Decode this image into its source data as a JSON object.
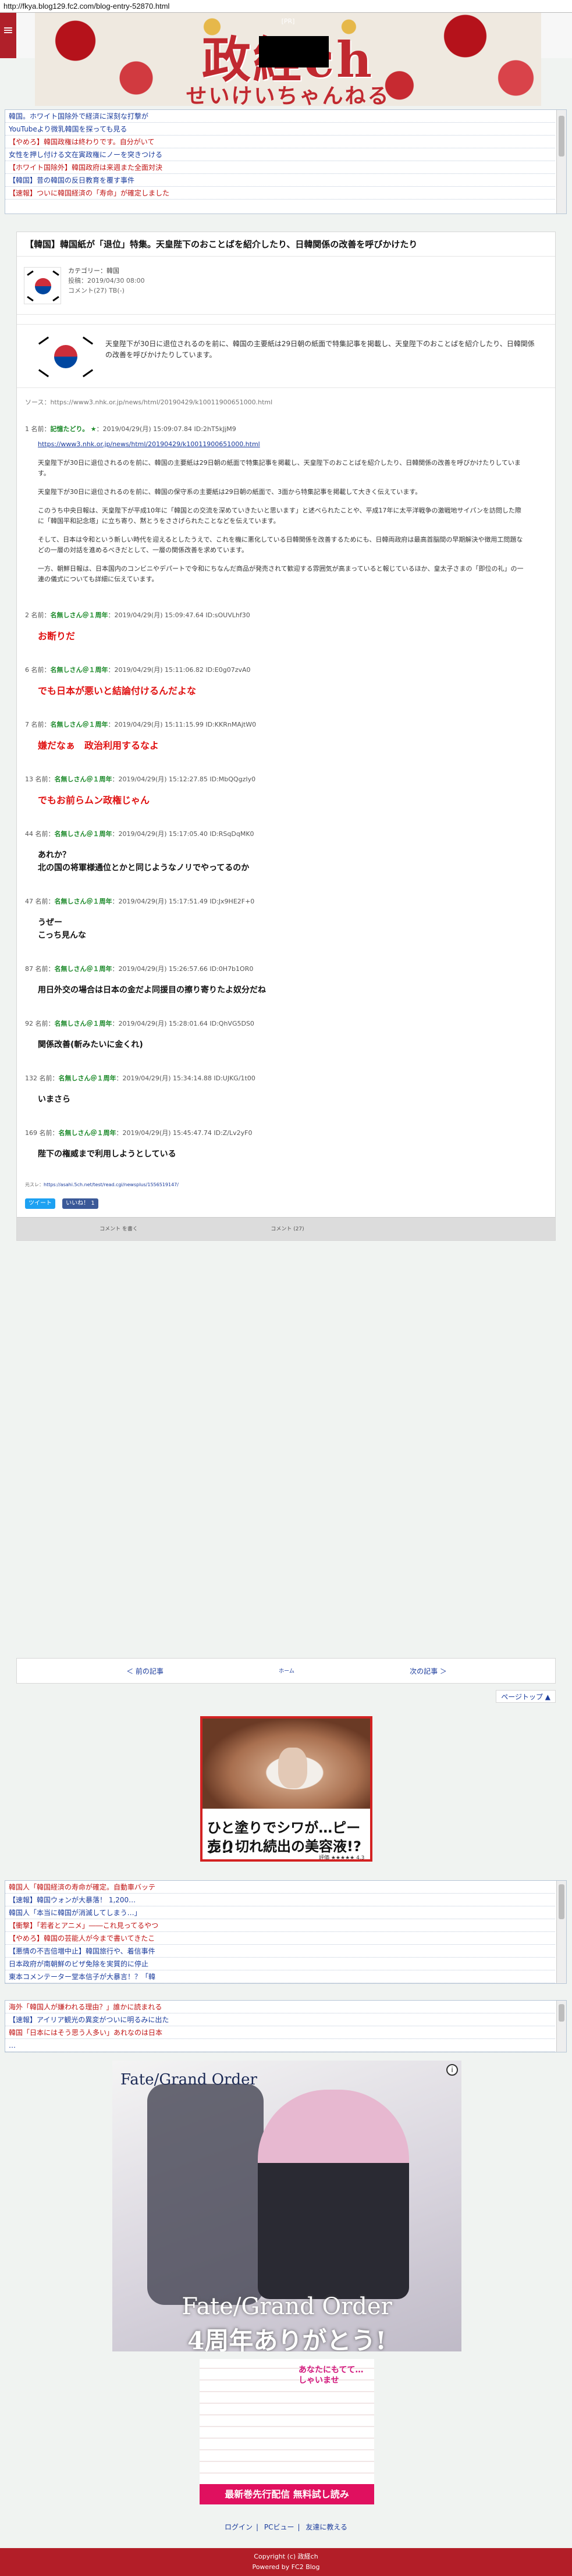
{
  "browser": {
    "url": "http://fkya.blog129.fc2.com/blog-entry-52870.html"
  },
  "header": {
    "menu_icon": "hamburger-icon",
    "pr": "[PR]",
    "title_main": "政経ch",
    "title_sub": "せいけいちゃんねる",
    "accent": "#b0202a"
  },
  "feed_top": [
    "韓国。ホワイト国除外で経済に深刻な打撃が",
    "YouTubeより微乳韓国を探っても見る",
    "【やめろ】韓国政権は終わりです。自分がいて",
    "女性を押し付ける文在寅政権にノーを突きつける",
    "【ホワイト国除外】韓国政府は来週また全面対決",
    "【韓国】昔の韓国の反日教育を覆す事件",
    "【速報】ついに韓国経済の「寿命」が確定しました"
  ],
  "article": {
    "title": "【韓国】韓国紙が「退位」特集。天皇陛下のおことばを紹介したり、日韓関係の改善を呼びかけたり",
    "category": "カテゴリー：韓国",
    "posted": "投稿：2019/04/30 08:00",
    "comments": "コメント(27)  TB(-)",
    "lead": "天皇陛下が30日に退位されるのを前に、韓国の主要紙は29日朝の紙面で特集記事を掲載し、天皇陛下のおことばを紹介したり、日韓関係の改善を呼びかけたりしています。",
    "source": "ソース：https://www3.nhk.or.jp/news/html/20190429/k10011900651000.html",
    "res1_head": {
      "num": "1 名前：",
      "name": "記憶たどり。",
      "rest": "：2019/04/29(月) 15:09:07.84 ID:2hT5kJjM9"
    },
    "res1_link": "https://www3.nhk.or.jp/news/html/20190429/k10011900651000.html",
    "res1_paras": [
      "天皇陛下が30日に退位されるのを前に、韓国の主要紙は29日朝の紙面で特集記事を掲載し、天皇陛下のおことばを紹介したり、日韓関係の改善を呼びかけたりしています。",
      "天皇陛下が30日に退位されるのを前に、韓国の保守系の主要紙は29日朝の紙面で、3面から特集記事を掲載して大きく伝えています。",
      "このうち中央日報は、天皇陛下が平成10年に「韓国との交流を深めていきたいと思います」と述べられたことや、平成17年に太平洋戦争の激戦地サイパンを訪問した際に「韓国平和記念塔」に立ち寄り、黙とうをささげられたことなどを伝えています。",
      "そして、日本は令和という新しい時代を迎えるとしたうえで、これを機に悪化している日韓関係を改善するためにも、日韓両政府は最高首脳間の早期解決や徴用工問題などの一層の対話を進めるべきだとして、一層の関係改善を求めています。",
      "一方、朝鮮日報は、日本国内のコンビニやデパートで令和にちなんだ商品が発売されて歓迎する雰囲気が高まっていると報じているほか、皇太子さまの「即位の礼」の一連の儀式についても詳細に伝えています。"
    ],
    "responses": [
      {
        "head": "2 名前：",
        "name": "名無しさん＠１周年",
        "rest": "：2019/04/29(月) 15:09:47.64 ID:sOUVLhf30",
        "body": "お断りだ",
        "red": true
      },
      {
        "head": "6 名前：",
        "name": "名無しさん＠１周年",
        "rest": "：2019/04/29(月) 15:11:06.82 ID:E0g07zvA0",
        "body": "でも日本が悪いと結論付けるんだよな",
        "red": true
      },
      {
        "head": "7 名前：",
        "name": "名無しさん＠１周年",
        "rest": "：2019/04/29(月) 15:11:15.99 ID:KKRnMAjtW0",
        "body": "嫌だなぁ　政治利用するなよ",
        "red": true
      },
      {
        "head": "13 名前：",
        "name": "名無しさん＠１周年",
        "rest": "：2019/04/29(月) 15:12:27.85 ID:MbQQgzIy0",
        "body": "でもお前らムン政権じゃん",
        "red": true
      },
      {
        "head": "44 名前：",
        "name": "名無しさん＠１周年",
        "rest": "：2019/04/29(月) 15:17:05.40 ID:RSqDqMK0",
        "body": "あれか？\n北の国の将軍様通位とかと同じようなノリでやってるのか",
        "red": false
      },
      {
        "head": "47 名前：",
        "name": "名無しさん＠１周年",
        "rest": "：2019/04/29(月) 15:17:51.49 ID:Jx9HE2F+0",
        "body": "うぜー\nこっち見んな",
        "red": false
      },
      {
        "head": "87 名前：",
        "name": "名無しさん＠１周年",
        "rest": "：2019/04/29(月) 15:26:57.66 ID:0H7b1OR0",
        "body": "用日外交の場合は日本の金だよ同援目の擦り寄りたよ奴分だね",
        "red": false
      },
      {
        "head": "92 名前：",
        "name": "名無しさん＠１周年",
        "rest": "：2019/04/29(月) 15:28:01.64 ID:QhVG5DS0",
        "body": "関係改善(斬みたいに金くれ)",
        "red": false
      },
      {
        "head": "132 名前：",
        "name": "名無しさん＠１周年",
        "rest": "：2019/04/29(月) 15:34:14.88 ID:UJKG/1t00",
        "body": "いまさら",
        "red": false
      },
      {
        "head": "169 名前：",
        "name": "名無しさん＠１周年",
        "rest": "：2019/04/29(月) 15:45:47.74 ID:Z/Lv2yF0",
        "body": "陛下の権威まで利用しようとしている",
        "red": false
      }
    ],
    "src2_label": "元スレ：",
    "src2_link": "https://asahi.5ch.net/test/read.cgi/newsplus/1556519147/",
    "sns_tweet": "ツイート",
    "sns_like": "いいね！ 1",
    "tools": {
      "comment_write": "コメント\nを書く",
      "comment_read": "コメント\n(27)"
    },
    "nav_prev": "＜ 前の記事",
    "nav_home": "ホーム",
    "nav_next": "次の記事 ＞"
  },
  "pagetop": "ページトップ ▲",
  "ad1": {
    "line1": "ひと塗りでシワが…ピーン!!",
    "line2": "売り切れ続出の美容液!?",
    "rating": "評価 ★★★★★ 4.3"
  },
  "feed_mid": [
    "韓国人「韓国経済の寿命が確定。自動車バッテ",
    "【速報】韓国ウォンが大暴落！ 1,200…",
    "韓国人「本当に韓国が消滅してしまう…」",
    "【衝撃】「若者とアニメ」――これ見ってるやつ",
    "【やめろ】韓国の芸能人が今まで書いてきたこ",
    "【悪情の不吉倍増中止】韓国旅行や、着信事件",
    "日本政府が南朝鮮のビザ免除を実質的に停止",
    "東本コメンテーター堂本信子が大暴言！？「韓"
  ],
  "feed_bottom": [
    "海外「韓国人が嫌われる理由？」誰かに読まれる",
    "【速報】アイリア観光の異変がついに明るみに出た",
    "韓国「日本にはそう思う人多い」あれなのは日本",
    "…"
  ],
  "ad2": {
    "logo": "Fate/Grand Order",
    "caption1": "Fate/Grand Order",
    "caption2": "4周年ありがとう!",
    "info_icon": "info-icon"
  },
  "ad3": {
    "manga": "あなたにもてて…しゃいませ",
    "band": "最新巻先行配信 無料試し読み"
  },
  "footer": {
    "links": [
      "ログイン",
      "PCビュー",
      "友達に教える"
    ],
    "copyright": "Copyright (c) 政経ch",
    "powered": "Powered by FC2 Blog"
  }
}
